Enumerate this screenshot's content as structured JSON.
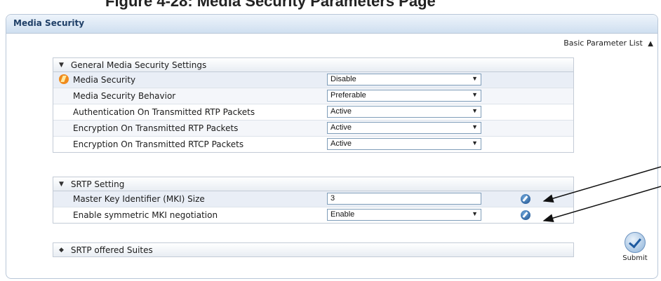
{
  "header": {
    "cut_title": "Figure 4-28: Media Security Parameters Page"
  },
  "panel": {
    "title": "Media Security",
    "basic_parameter_list": "Basic Parameter List"
  },
  "groups": [
    {
      "title": "General Media Security Settings",
      "rows": [
        {
          "label": "Media Security",
          "value": "Disable",
          "control": "select"
        },
        {
          "label": "Media Security Behavior",
          "value": "Preferable",
          "control": "select"
        },
        {
          "label": "Authentication On Transmitted RTP Packets",
          "value": "Active",
          "control": "select"
        },
        {
          "label": "Encryption On Transmitted RTP Packets",
          "value": "Active",
          "control": "select"
        },
        {
          "label": "Encryption On Transmitted RTCP Packets",
          "value": "Active",
          "control": "select"
        }
      ]
    },
    {
      "title": "SRTP Setting",
      "rows": [
        {
          "label": "Master Key Identifier (MKI) Size",
          "value": "3",
          "control": "input"
        },
        {
          "label": "Enable symmetric MKI negotiation",
          "value": "Enable",
          "control": "select"
        }
      ]
    },
    {
      "title": "SRTP offered Suites",
      "rows": []
    }
  ],
  "submit": {
    "label": "Submit"
  },
  "colors": {
    "header_text": "#1f3f67",
    "border": "#b9c7d8",
    "annotation": "#111111"
  }
}
